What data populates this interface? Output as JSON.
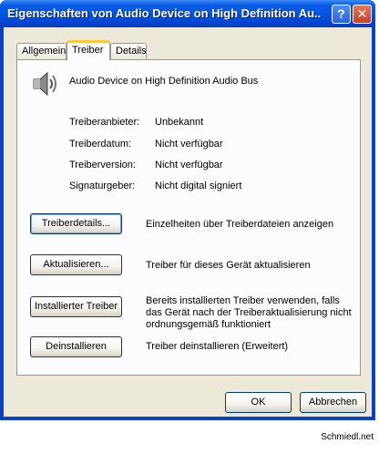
{
  "window": {
    "title": "Eigenschaften von Audio Device on High Definition Au...",
    "help_label": "?",
    "close_label": "✕"
  },
  "tabs": [
    {
      "label": "Allgemein",
      "active": false
    },
    {
      "label": "Treiber",
      "active": true
    },
    {
      "label": "Details",
      "active": false
    }
  ],
  "device": {
    "icon": "speaker-icon",
    "name": "Audio Device on High Definition Audio Bus"
  },
  "properties": [
    {
      "label": "Treiberanbieter:",
      "value": "Unbekannt"
    },
    {
      "label": "Treiberdatum:",
      "value": "Nicht verfügbar"
    },
    {
      "label": "Treiberversion:",
      "value": "Nicht verfügbar"
    },
    {
      "label": "Signaturgeber:",
      "value": "Nicht digital signiert"
    }
  ],
  "actions": [
    {
      "label": "Treiberdetails...",
      "description": "Einzelheiten über Treiberdateien anzeigen"
    },
    {
      "label": "Aktualisieren...",
      "description": "Treiber für dieses Gerät aktualisieren"
    },
    {
      "label": "Installierter Treiber",
      "description": "Bereits installierten Treiber verwenden, falls das Gerät nach der Treiberaktualisierung nicht ordnungsgemäß funktioniert"
    },
    {
      "label": "Deinstallieren",
      "description": "Treiber deinstallieren (Erweitert)"
    }
  ],
  "footer_buttons": {
    "ok": "OK",
    "cancel": "Abbrechen"
  },
  "watermark": "Schmiedl.net"
}
